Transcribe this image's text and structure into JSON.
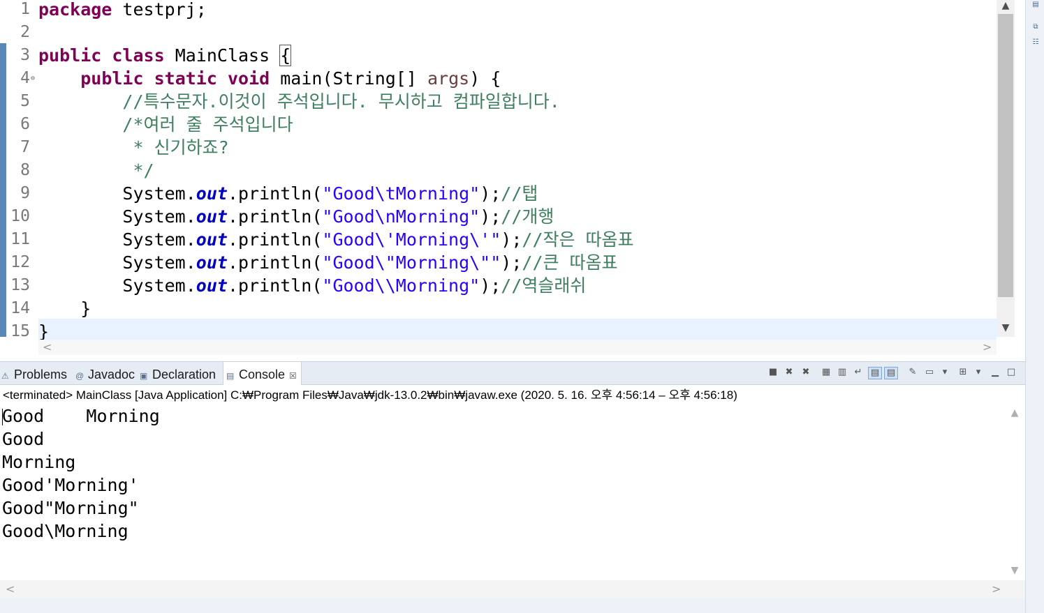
{
  "editor": {
    "line_numbers": [
      "1",
      "2",
      "3",
      "4",
      "5",
      "6",
      "7",
      "8",
      "9",
      "10",
      "11",
      "12",
      "13",
      "14",
      "15"
    ],
    "fold_marker": "⊖",
    "lines": {
      "l1": {
        "kw": "package",
        "rest": " testprj;"
      },
      "l3": {
        "kw1": "public",
        "kw2": "class",
        "name": " MainClass ",
        "brace": "{"
      },
      "l4": {
        "kw1": "public",
        "kw2": "static",
        "kw3": "void",
        "sig": " main(String[] ",
        "arg": "args",
        "end": ") {"
      },
      "l5": {
        "cmt": "//특수문자.이것이 주석입니다. 무시하고 컴파일합니다."
      },
      "l6": {
        "cmt": "/*여러 줄 주석입니다"
      },
      "l7": {
        "cmt": " * 신기하죠?"
      },
      "l8": {
        "cmt": " */"
      },
      "l9": {
        "pre": "System.",
        "fld": "out",
        "mid": ".println(",
        "str": "\"Good\\tMorning\"",
        "post": ");",
        "cmt": "//탭"
      },
      "l10": {
        "pre": "System.",
        "fld": "out",
        "mid": ".println(",
        "str": "\"Good\\nMorning\"",
        "post": ");",
        "cmt": "//개행"
      },
      "l11": {
        "pre": "System.",
        "fld": "out",
        "mid": ".println(",
        "str": "\"Good\\'Morning\\'\"",
        "post": ");",
        "cmt": "//작은 따옴표"
      },
      "l12": {
        "pre": "System.",
        "fld": "out",
        "mid": ".println(",
        "str": "\"Good\\\"Morning\\\"\"",
        "post": ");",
        "cmt": "//큰 따옴표"
      },
      "l13": {
        "pre": "System.",
        "fld": "out",
        "mid": ".println(",
        "str": "\"Good\\\\Morning\"",
        "post": ");",
        "cmt": "//역슬래쉬"
      },
      "l14": {
        "text": "}"
      },
      "l15": {
        "text": "}"
      }
    }
  },
  "views": {
    "tabs": [
      {
        "label": "Problems",
        "icon": "problems-icon"
      },
      {
        "label": "Javadoc",
        "icon": "javadoc-icon"
      },
      {
        "label": "Declaration",
        "icon": "declaration-icon"
      },
      {
        "label": "Console",
        "icon": "console-icon",
        "active": true
      }
    ],
    "close_glyph": "☒"
  },
  "console": {
    "header": "<terminated> MainClass [Java Application] C:₩Program Files₩Java₩jdk-13.0.2₩bin₩javaw.exe  (2020. 5. 16. 오후 4:56:14 – 오후 4:56:18)",
    "output": [
      "Good\tMorning",
      "Good",
      "Morning",
      "Good'Morning'",
      "Good\"Morning\"",
      "Good\\Morning"
    ]
  },
  "scroll": {
    "up": "▲",
    "down": "▼",
    "left": "<",
    "right": ">"
  }
}
